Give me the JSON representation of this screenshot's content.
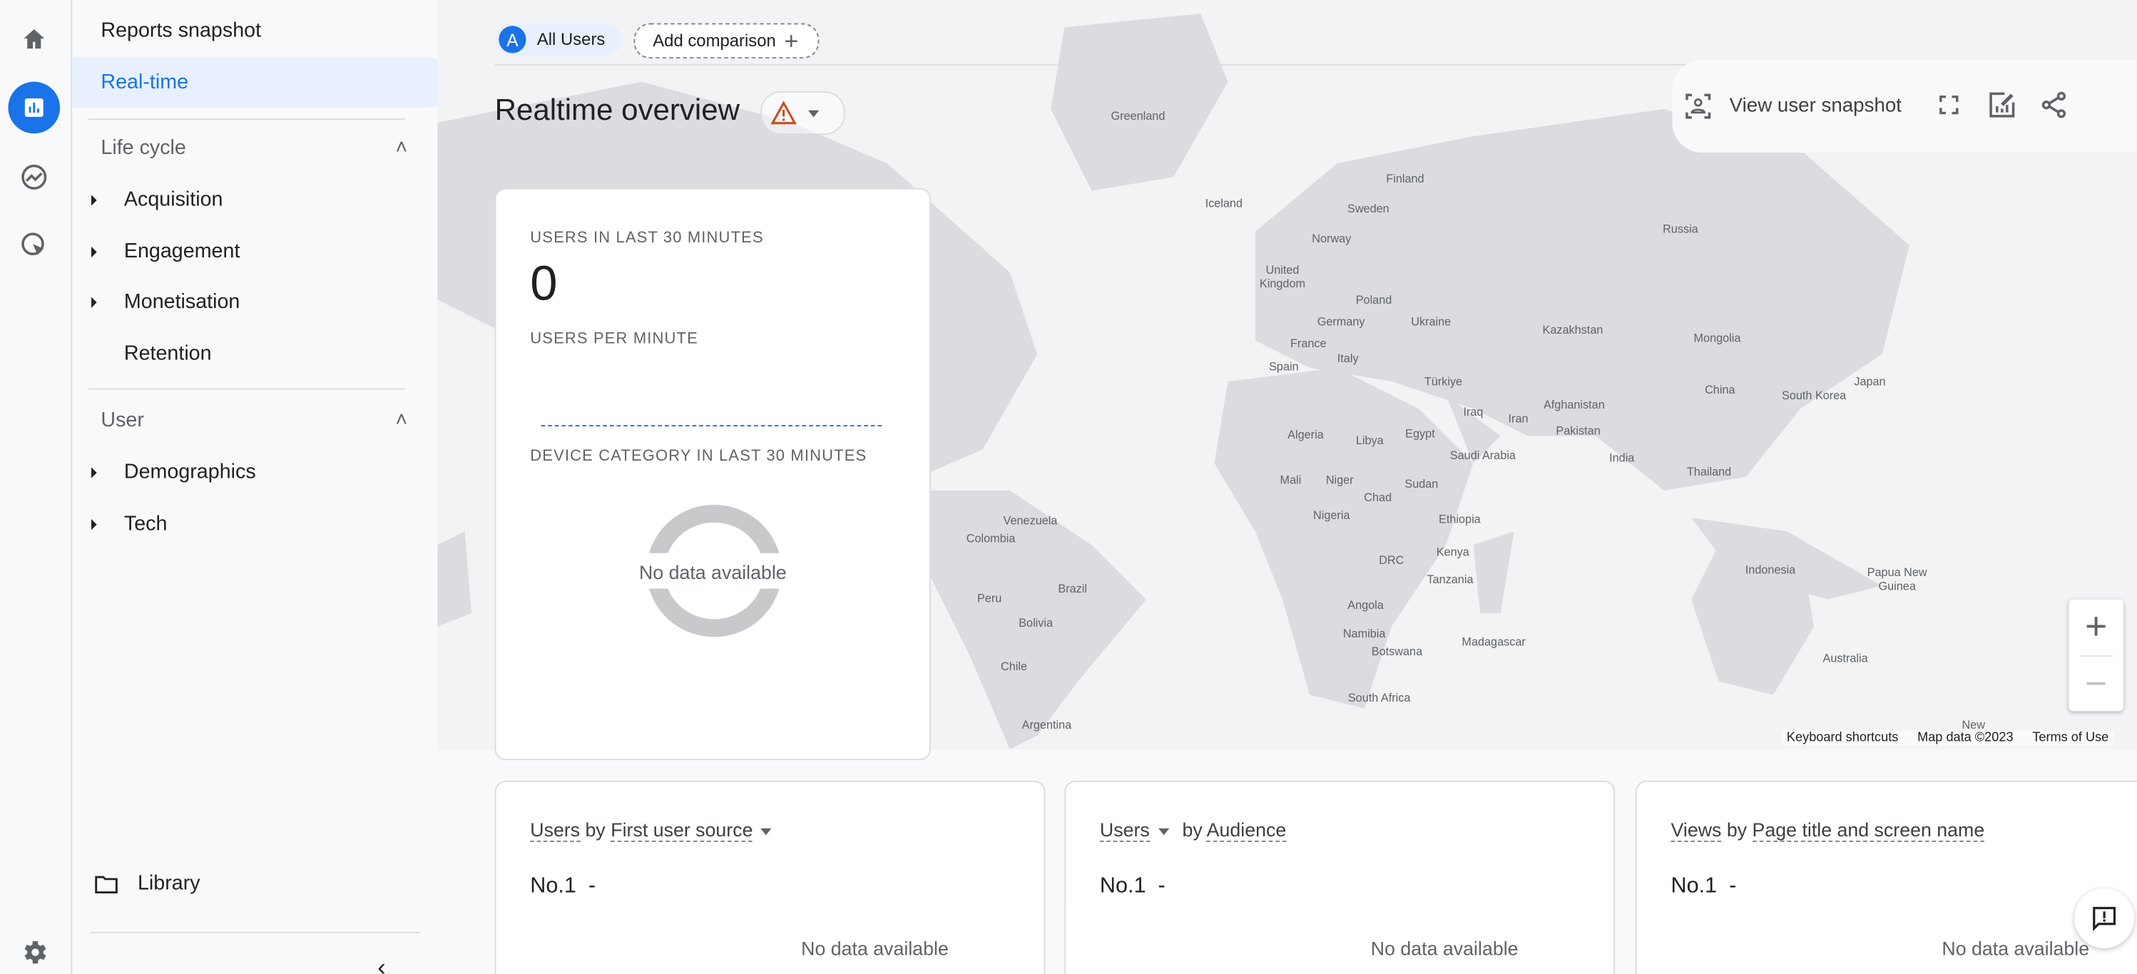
{
  "rail": {
    "items": [
      "home-icon",
      "reports-icon",
      "explore-icon",
      "advertising-icon",
      "settings-icon"
    ]
  },
  "nav": {
    "reports_snapshot": "Reports snapshot",
    "realtime": "Real-time",
    "lifecycle": {
      "title": "Life cycle",
      "items": [
        "Acquisition",
        "Engagement",
        "Monetisation",
        "Retention"
      ]
    },
    "user": {
      "title": "User",
      "items": [
        "Demographics",
        "Tech"
      ]
    },
    "library": "Library"
  },
  "header": {
    "segment_badge": "A",
    "segment_label": "All Users",
    "add_comparison": "Add comparison",
    "title": "Realtime overview",
    "view_user_snapshot": "View user snapshot"
  },
  "realtime_card": {
    "users_label": "USERS IN LAST 30 MINUTES",
    "users_value": "0",
    "per_minute_label": "USERS PER MINUTE",
    "device_label": "DEVICE CATEGORY IN LAST 30 MINUTES",
    "no_data": "No data available"
  },
  "map": {
    "countries": [
      "Greenland",
      "Iceland",
      "Finland",
      "Sweden",
      "Norway",
      "Russia",
      "United Kingdom",
      "Poland",
      "Ukraine",
      "Kazakhstan",
      "Mongolia",
      "Germany",
      "France",
      "Italy",
      "Spain",
      "Türkiye",
      "Iraq",
      "Iran",
      "Afghanistan",
      "Pakistan",
      "China",
      "South Korea",
      "Japan",
      "India",
      "Thailand",
      "Algeria",
      "Libya",
      "Egypt",
      "Saudi Arabia",
      "Mali",
      "Niger",
      "Chad",
      "Sudan",
      "Nigeria",
      "Ethiopia",
      "Kenya",
      "DRC",
      "Tanzania",
      "Angola",
      "Namibia",
      "Botswana",
      "Madagascar",
      "South Africa",
      "Indonesia",
      "Papua New Guinea",
      "Australia",
      "Venezuela",
      "Colombia",
      "Brazil",
      "Peru",
      "Bolivia",
      "Chile",
      "Argentina",
      "New"
    ],
    "footer": [
      "Keyboard shortcuts",
      "Map data ©2023",
      "Terms of Use"
    ]
  },
  "bottom_cards": [
    {
      "metric": "Users",
      "by": "by",
      "dimension": "First user source",
      "rank": "No.1",
      "rank_value": "-",
      "no_data": "No data available"
    },
    {
      "metric": "Users",
      "by": "by",
      "dimension": "Audience",
      "rank": "No.1",
      "rank_value": "-",
      "no_data": "No data available"
    },
    {
      "metric": "Views",
      "by": "by",
      "dimension": "Page title and screen name",
      "rank": "No.1",
      "rank_value": "-",
      "no_data": "No data available"
    }
  ],
  "colors": {
    "accent": "#1a73e8",
    "warning": "#c5221f",
    "map_land": "#dadce0"
  }
}
